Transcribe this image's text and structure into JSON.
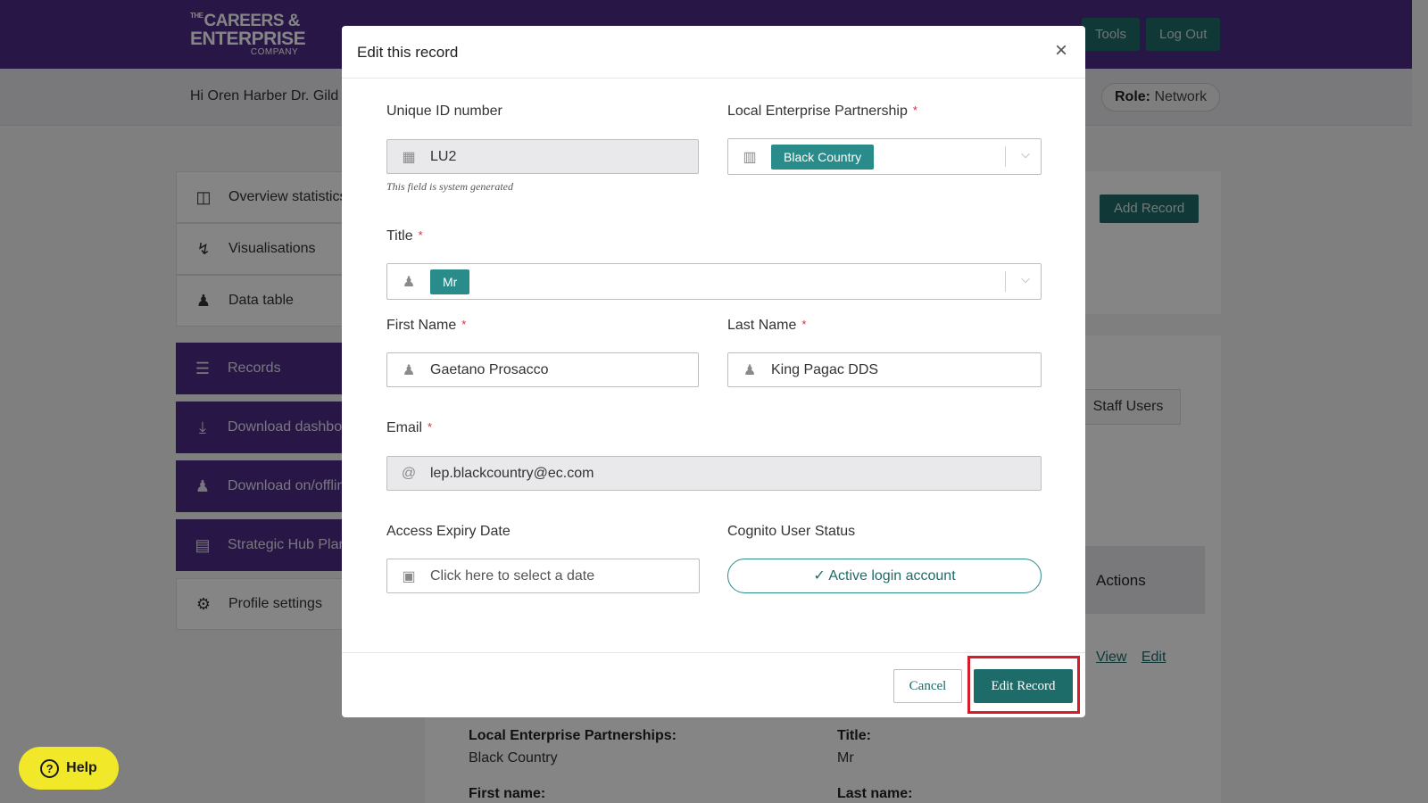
{
  "brand": {
    "line1_prefix": "THE",
    "line1": "CAREERS &",
    "line2": "ENTERPRISE",
    "line3": "COMPANY"
  },
  "topnav": {
    "tools": "Tools",
    "logout": "Log Out"
  },
  "userbar": {
    "greeting": "Hi Oren Harber Dr. Gild",
    "role_label": "Role:",
    "role_value": "Network"
  },
  "sidebar": {
    "items": [
      {
        "label": "Overview statistics",
        "icon": "search-chart-icon"
      },
      {
        "label": "Visualisations",
        "icon": "chart-icon"
      },
      {
        "label": "Data table",
        "icon": "person-icon"
      },
      {
        "label": "Records",
        "icon": "list-icon"
      },
      {
        "label": "Download dashboard",
        "icon": "download-icon"
      },
      {
        "label": "Download on/offline",
        "icon": "users-icon"
      },
      {
        "label": "Strategic Hub Plan",
        "icon": "window-icon"
      },
      {
        "label": "Profile settings",
        "icon": "gear-icon"
      }
    ]
  },
  "background": {
    "add_record": "Add Record",
    "staff_users": "Staff Users",
    "actions_header": "Actions",
    "view_link": "View",
    "edit_link": "Edit",
    "details": {
      "lep_label": "Local Enterprise Partnerships:",
      "lep_value": "Black Country",
      "title_label": "Title:",
      "title_value": "Mr",
      "first_label": "First name:",
      "last_label": "Last name:"
    }
  },
  "help": {
    "label": "Help"
  },
  "modal": {
    "title": "Edit this record",
    "fields": {
      "unique_id": {
        "label": "Unique ID number",
        "value": "LU2",
        "hint": "This field is system generated"
      },
      "lep": {
        "label": "Local Enterprise Partnership",
        "value": "Black Country"
      },
      "title": {
        "label": "Title",
        "value": "Mr"
      },
      "first_name": {
        "label": "First Name",
        "value": "Gaetano Prosacco"
      },
      "last_name": {
        "label": "Last Name",
        "value": "King Pagac DDS"
      },
      "email": {
        "label": "Email",
        "value": "lep.blackcountry@ec.com"
      },
      "expiry": {
        "label": "Access Expiry Date",
        "placeholder": "Click here to select a date"
      },
      "cognito": {
        "label": "Cognito User Status",
        "value": "Active login account"
      }
    },
    "required_mark": "*",
    "cancel": "Cancel",
    "submit": "Edit Record"
  },
  "colors": {
    "brand_purple": "#4e2d87",
    "teal": "#1e6c6a",
    "highlight": "#d41c2b"
  }
}
